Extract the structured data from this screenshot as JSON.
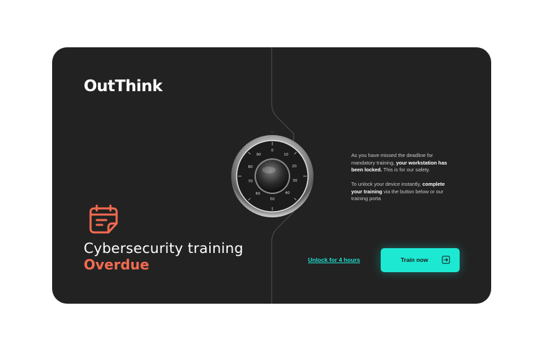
{
  "brand": {
    "logo_text": "OutThink"
  },
  "headline": {
    "title": "Cybersecurity training",
    "status": "Overdue"
  },
  "message": {
    "p1_before": "As you have missed the deadline for mandatory training, ",
    "p1_bold": "your workstation has been locked.",
    "p1_after": " This is for our safety.",
    "p2_before": "To unlock your device instantly, ",
    "p2_bold": "complete your training",
    "p2_after": " via the button below or our training porta"
  },
  "actions": {
    "unlock_label": "Unlock for 4 hours",
    "train_label": "Train now"
  },
  "dial": {
    "numbers": [
      "0",
      "10",
      "20",
      "30",
      "40",
      "50",
      "60",
      "70",
      "80",
      "90"
    ]
  },
  "icons": {
    "calendar": "calendar-icon",
    "safe_dial": "combination-lock-icon",
    "arrow": "arrow-right-icon"
  },
  "colors": {
    "background": "#222222",
    "accent_orange": "#f26b50",
    "accent_teal": "#1de9d3",
    "text_white": "#ffffff"
  }
}
